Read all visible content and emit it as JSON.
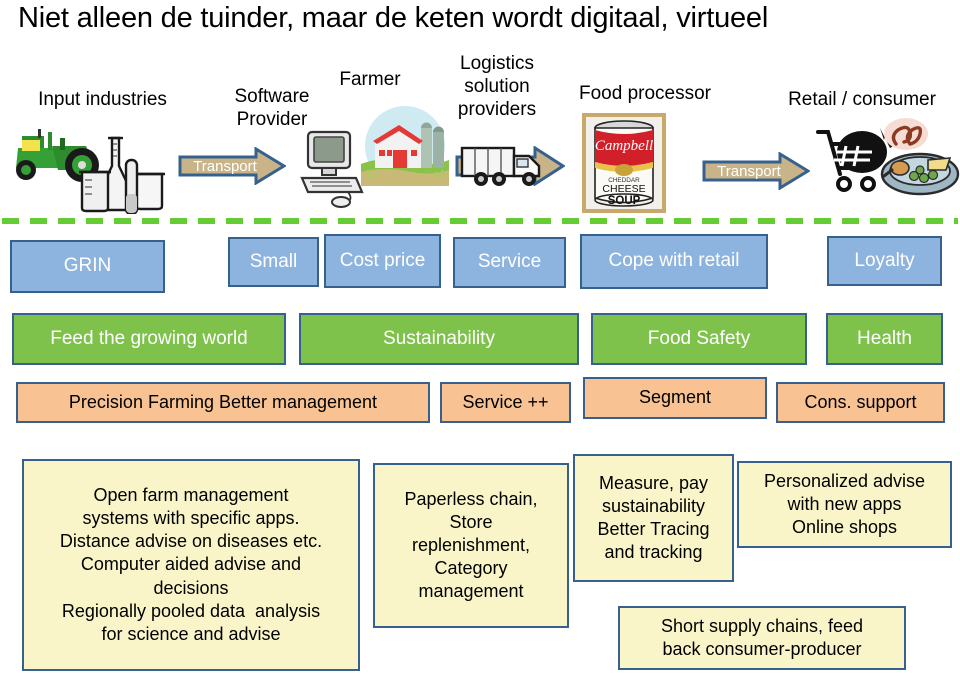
{
  "title": "Niet alleen de tuinder, maar de keten wordt digitaal, virtueel",
  "chain": {
    "stages": [
      {
        "label": "Input industries",
        "icon": "tractor-and-lab-glassware-icon"
      },
      {
        "label": "Software\nProvider",
        "icon": "desktop-computer-icon"
      },
      {
        "label": "Farmer",
        "icon": "farm-barn-silo-icon"
      },
      {
        "label": "Logistics\nsolution\nproviders",
        "icon": "delivery-truck-icon"
      },
      {
        "label": "Food processor",
        "icon": "campbells-soup-can-icon"
      },
      {
        "label": "Retail / consumer",
        "icon": "shopping-cart-and-meal-plate-icon"
      }
    ],
    "arrows": [
      {
        "label": "Transport",
        "name": "transport-arrow-1"
      },
      {
        "label": "",
        "name": "logistics-arrow"
      },
      {
        "label": "Transport",
        "name": "transport-arrow-2"
      }
    ]
  },
  "rows": {
    "blue": [
      {
        "label": "GRIN"
      },
      {
        "label": "Small"
      },
      {
        "label": "Cost price"
      },
      {
        "label": "Service"
      },
      {
        "label": "Cope with retail"
      },
      {
        "label": "Loyalty"
      }
    ],
    "green": [
      {
        "label": "Feed the growing world"
      },
      {
        "label": "Sustainability"
      },
      {
        "label": "Food Safety"
      },
      {
        "label": "Health"
      }
    ],
    "orange": [
      {
        "label": "Precision Farming Better management"
      },
      {
        "label": "Service ++"
      },
      {
        "label": "Segment"
      },
      {
        "label": "Cons. support"
      }
    ],
    "yellow": [
      {
        "label": "Open farm management systems with specific apps.\nDistance advise on diseases etc.\nComputer aided advise and decisions\nRegionally pooled data  analysis for science and advise"
      },
      {
        "label": "Paperless chain, Store replenishment, Category management"
      },
      {
        "label": "Measure, pay sustainability Better Tracing and tracking"
      },
      {
        "label": "Personalized advise with new apps Online shops"
      },
      {
        "label": "Short supply chains, feed back consumer-producer"
      }
    ]
  },
  "colors": {
    "blue_fill": "#8DB3DF",
    "green_fill": "#7FC24B",
    "orange_fill": "#F8C293",
    "yellow_fill": "#FAF5C8",
    "border": "#36618E",
    "divider_green": "#66CC33",
    "arrow_fill": "#C9B489"
  }
}
